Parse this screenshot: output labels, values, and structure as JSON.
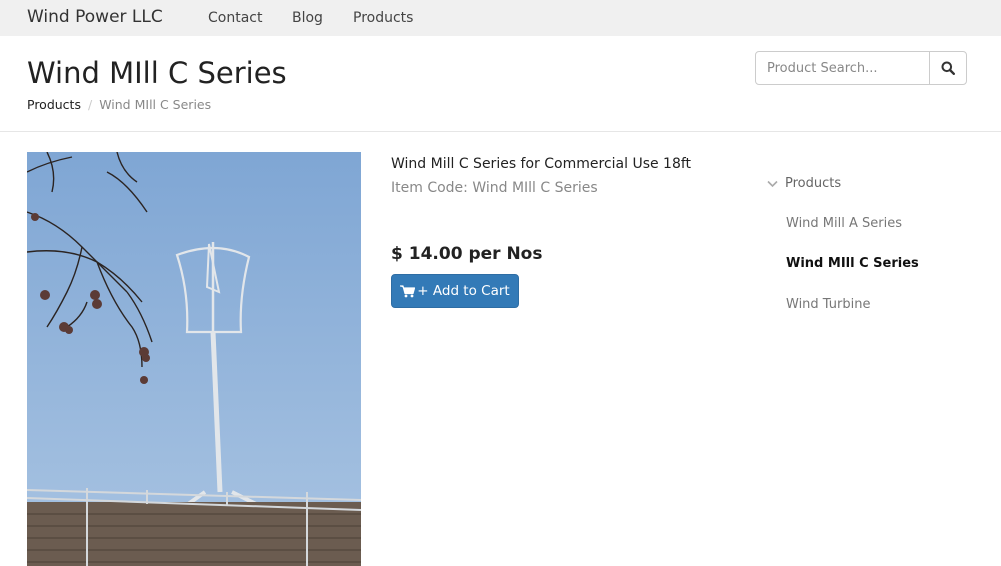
{
  "navbar": {
    "brand": "Wind Power LLC",
    "links": [
      "Contact",
      "Blog",
      "Products"
    ]
  },
  "page": {
    "title": "Wind MIll C Series",
    "breadcrumb": {
      "parent": "Products",
      "separator": "/",
      "current": "Wind MIll C Series"
    }
  },
  "search": {
    "placeholder": "Product Search...",
    "button_icon": "search-icon"
  },
  "product": {
    "name": "Wind Mill C Series for Commercial Use 18ft",
    "item_code": "Item Code: Wind MIll C Series",
    "price": "$ 14.00 per Nos",
    "add_to_cart_label": "+ Add to Cart",
    "cart_icon": "shopping-cart-icon",
    "image": "photo of vertical-axis wind turbine on building roof against blue sky"
  },
  "sidebar": {
    "heading": "Products",
    "heading_icon": "chevron-down-icon",
    "items": [
      {
        "label": "Wind Mill A Series",
        "active": false
      },
      {
        "label": "Wind MIll C Series",
        "active": true
      },
      {
        "label": "Wind Turbine",
        "active": false
      }
    ]
  },
  "colors": {
    "navbar_bg": "#f0f0f0",
    "primary_button": "#337ab7",
    "sky": "#8fb3d9"
  }
}
